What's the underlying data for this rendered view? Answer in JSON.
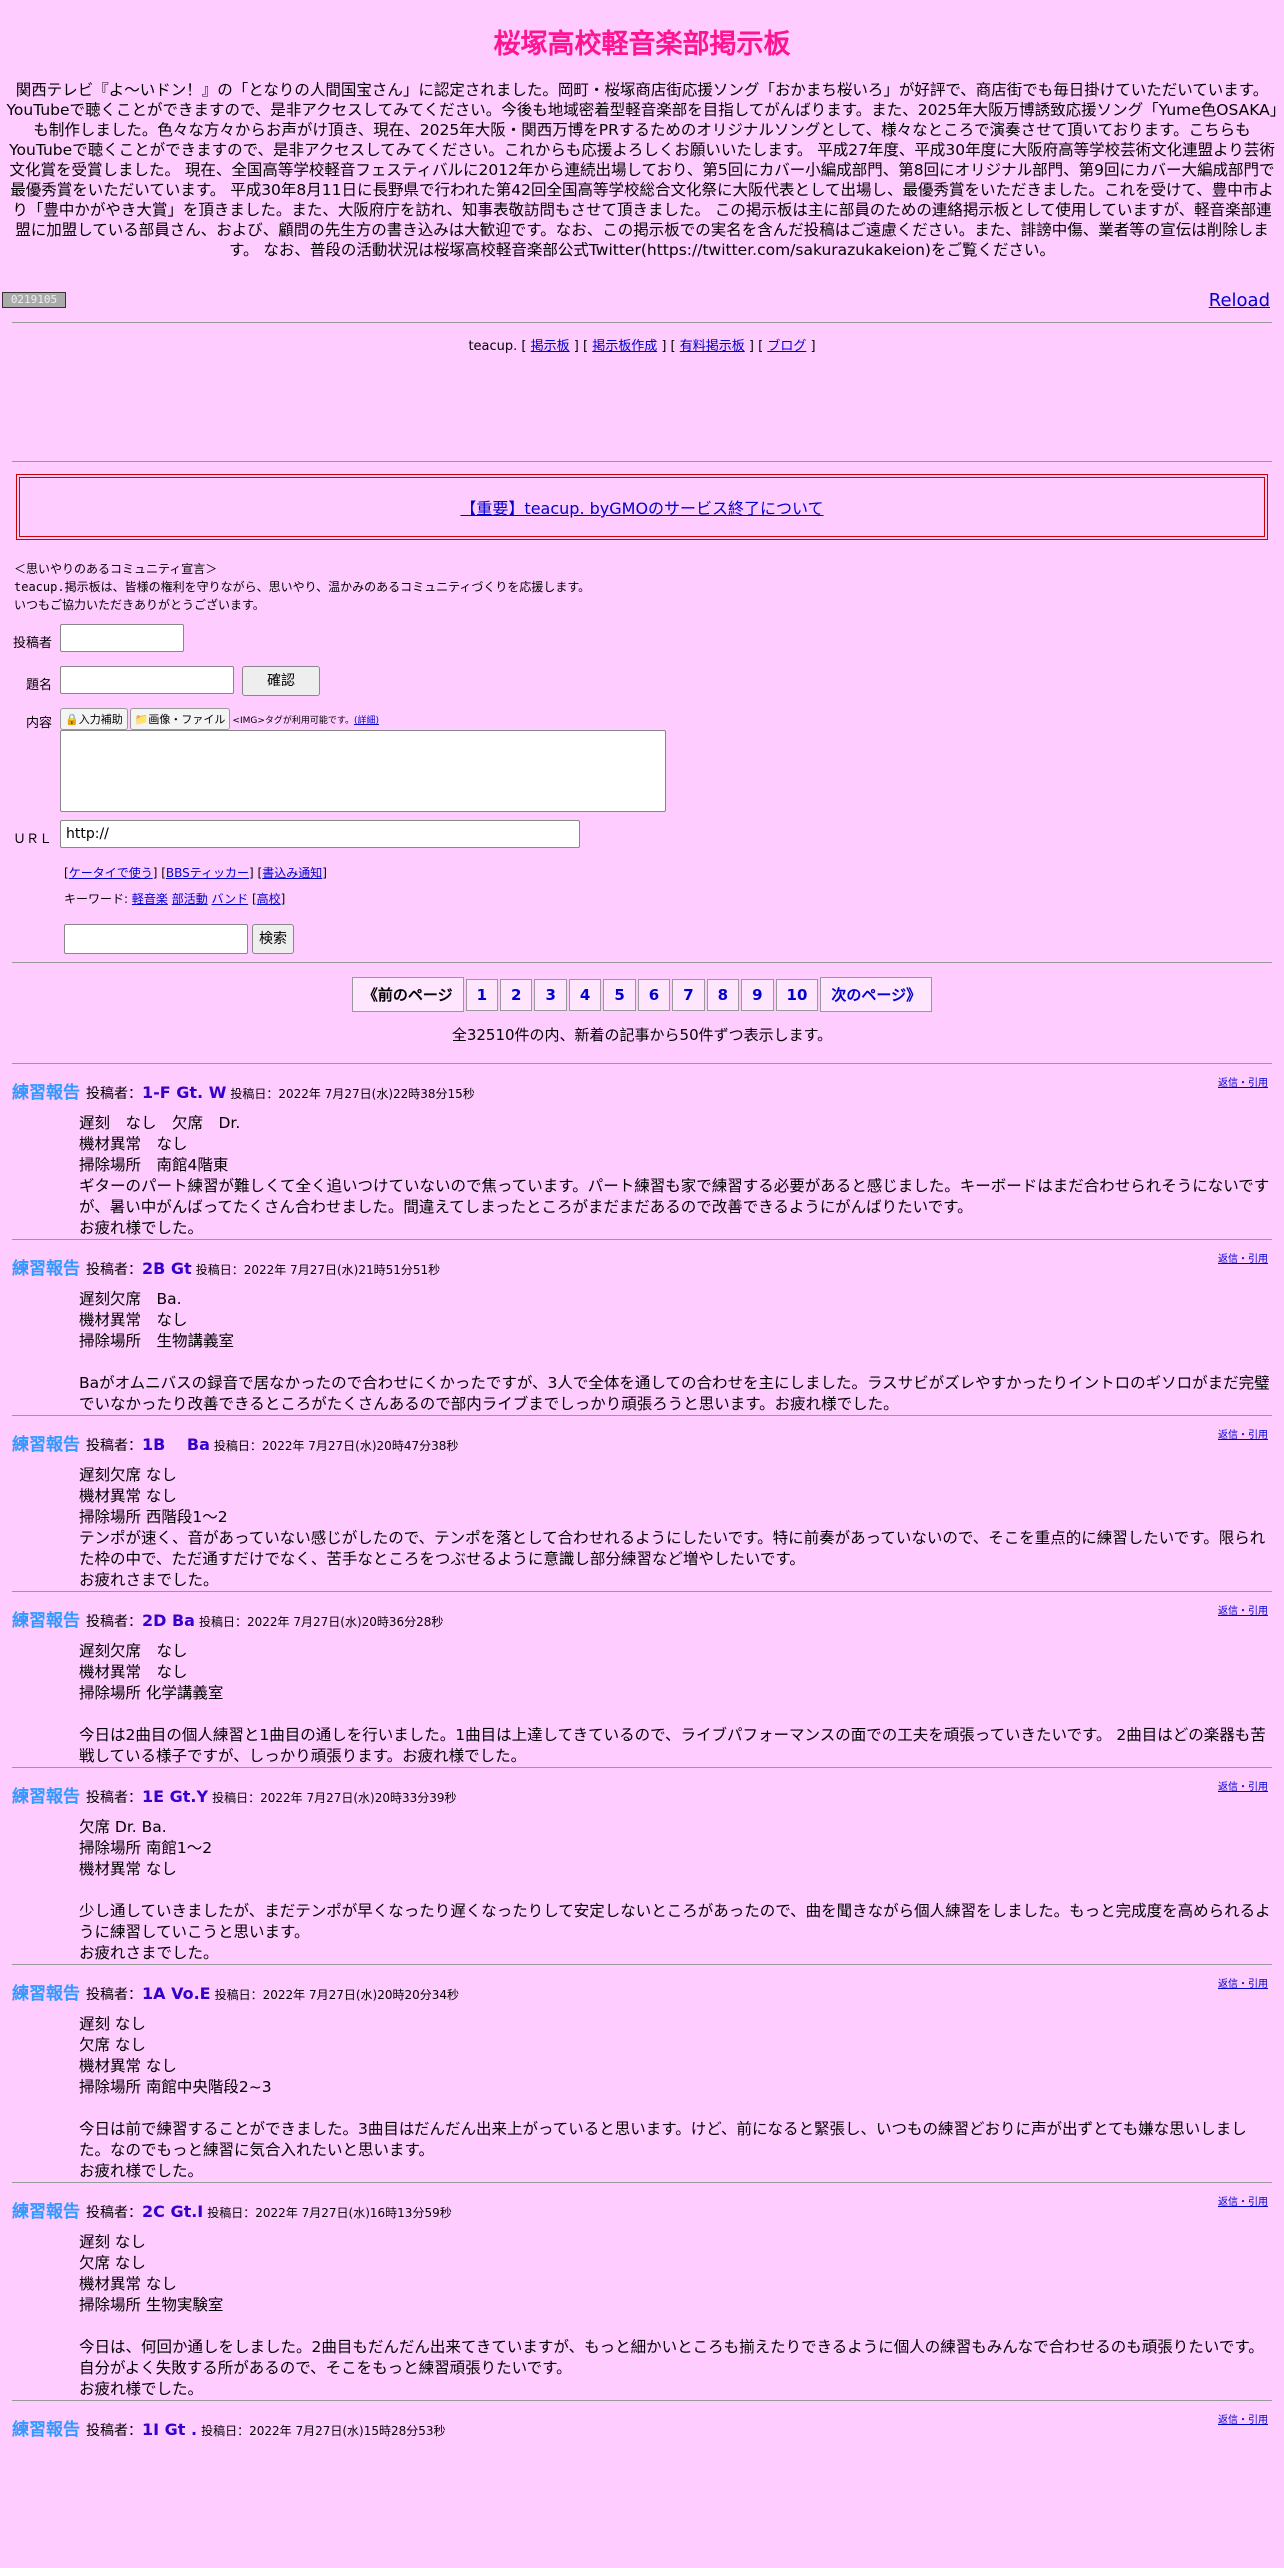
{
  "title": "桜塚高校軽音楽部掲示板",
  "intro": "関西テレビ『よ～いドン！』の「となりの人間国宝さん」に認定されました。岡町・桜塚商店街応援ソング「おかまち桜いろ」が好評で、商店街でも毎日掛けていただいています。YouTubeで聴くことができますので、是非アクセスしてみてください。今後も地域密着型軽音楽部を目指してがんばります。また、2025年大阪万博誘致応援ソング「Yume色OSAKA」も制作しました。色々な方々からお声がけ頂き、現在、2025年大阪・関西万博をPRするためのオリジナルソングとして、様々なところで演奏させて頂いております。こちらもYouTubeで聴くことができますので、是非アクセスしてみてください。これからも応援よろしくお願いいたします。 平成27年度、平成30年度に大阪府高等学校芸術文化連盟より芸術文化賞を受賞しました。 現在、全国高等学校軽音フェスティバルに2012年から連続出場しており、第5回にカバー小編成部門、第8回にオリジナル部門、第9回にカバー大編成部門で最優秀賞をいただいています。 平成30年8月11日に長野県で行われた第42回全国高等学校総合文化祭に大阪代表として出場し、最優秀賞をいただきました。これを受けて、豊中市より「豊中かがやき大賞」を頂きました。また、大阪府庁を訪れ、知事表敬訪問もさせて頂きました。 この掲示板は主に部員のための連絡掲示板として使用していますが、軽音楽部連盟に加盟している部員さん、および、顧問の先生方の書き込みは大歓迎です。なお、この掲示板での実名を含んだ投稿はご遠慮ください。また、誹謗中傷、業者等の宣伝は削除します。 なお、普段の活動状況は桜塚高校軽音楽部公式Twitter(https://twitter.com/sakurazukakeion)をご覧ください。",
  "counter": "0219105",
  "reload": "Reload",
  "teacup": {
    "prefix": "teacup. [ ",
    "links": [
      "掲示板",
      "掲示板作成",
      "有料掲示板",
      "ブログ"
    ]
  },
  "notice": "【重要】teacup. byGMOのサービス終了について",
  "community": {
    "line1": "＜思いやりのあるコミュニティ宣言＞",
    "line2": "teacup.掲示板は、皆様の権利を守りながら、思いやり、温かみのあるコミュニティづくりを応援します。",
    "line3": "いつもご協力いただきありがとうございます。"
  },
  "form": {
    "author_label": "投稿者",
    "subject_label": "題名",
    "confirm_button": "確認",
    "content_label": "内容",
    "tool_input": "入力補助",
    "tool_image": "画像・ファイル",
    "img_note": "<IMG>タグが利用可能です。",
    "img_detail": "(詳細)",
    "url_label": "ＵＲＬ",
    "url_value": "http://",
    "links": [
      "ケータイで使う",
      "BBSティッカー",
      "書込み通知"
    ],
    "keyword_label": "キーワード: ",
    "keywords": [
      "軽音楽",
      "部活動",
      "バンド",
      "高校"
    ],
    "search_button": "検索"
  },
  "pager": {
    "prev": "《前のページ",
    "pages": [
      "1",
      "2",
      "3",
      "4",
      "5",
      "6",
      "7",
      "8",
      "9",
      "10"
    ],
    "next": "次のページ》"
  },
  "total": "全32510件の内、新着の記事から50件ずつ表示します。",
  "post_label": "投稿者：",
  "date_label": "投稿日：",
  "reply_label": "返信・引用",
  "posts": [
    {
      "title": "練習報告",
      "author": "1-F Gt. W",
      "date": "2022年 7月27日(水)22時38分15秒",
      "body": "遅刻　なし　欠席　Dr.\n機材異常　なし\n掃除場所　南館4階東\nギターのパート練習が難しくて全く追いつけていないので焦っています。パート練習も家で練習する必要があると感じました。キーボードはまだ合わせられそうにないですが、暑い中がんばってたくさん合わせました。間違えてしまったところがまだまだあるので改善できるようにがんばりたいです。\nお疲れ様でした。\n"
    },
    {
      "title": "練習報告",
      "author": "2B Gt",
      "date": "2022年 7月27日(水)21時51分51秒",
      "body": "遅刻欠席　Ba.\n機材異常　なし\n掃除場所　生物講義室\n\nBaがオムニバスの録音で居なかったので合わせにくかったですが、3人で全体を通しての合わせを主にしました。ラスサビがズレやすかったりイントロのギソロがまだ完璧でいなかったり改善できるところがたくさんあるので部内ライブまでしっかり頑張ろうと思います。お疲れ様でした。"
    },
    {
      "title": "練習報告",
      "author": "1B　 Ba",
      "date": "2022年 7月27日(水)20時47分38秒",
      "body": "遅刻欠席 なし\n機材異常 なし\n掃除場所 西階段1～2\nテンポが速く、音があっていない感じがしたので、テンポを落として合わせれるようにしたいです。特に前奏があっていないので、そこを重点的に練習したいです。限られた枠の中で、ただ通すだけでなく、苦手なところをつぶせるように意識し部分練習など増やしたいです。\nお疲れさまでした。"
    },
    {
      "title": "練習報告",
      "author": "2D Ba",
      "date": "2022年 7月27日(水)20時36分28秒",
      "body": "遅刻欠席　なし\n機材異常　なし\n掃除場所 化学講義室\n\n今日は2曲目の個人練習と1曲目の通しを行いました。1曲目は上達してきているので、ライブパフォーマンスの面での工夫を頑張っていきたいです。 2曲目はどの楽器も苦戦している様子ですが、しっかり頑張ります。お疲れ様でした。"
    },
    {
      "title": "練習報告",
      "author": "1E Gt.Y",
      "date": "2022年 7月27日(水)20時33分39秒",
      "body": "欠席 Dr. Ba.\n掃除場所 南館1～2\n機材異常 なし\n\n少し通していきましたが、まだテンポが早くなったり遅くなったりして安定しないところがあったので、曲を聞きながら個人練習をしました。もっと完成度を高められるように練習していこうと思います。\nお疲れさまでした。\n"
    },
    {
      "title": "練習報告",
      "author": "1A Vo.E",
      "date": "2022年 7月27日(水)20時20分34秒",
      "body": "遅刻 なし\n欠席 なし\n機材異常 なし\n掃除場所 南館中央階段2~3\n\n今日は前で練習することができました。3曲目はだんだん出来上がっていると思います。けど、前になると緊張し、いつもの練習どおりに声が出ずとても嫌な思いしました。なのでもっと練習に気合入れたいと思います。\nお疲れ様でした。"
    },
    {
      "title": "練習報告",
      "author": "2C Gt.I",
      "date": "2022年 7月27日(水)16時13分59秒",
      "body": "遅刻 なし\n欠席 なし\n機材異常 なし\n掃除場所 生物実験室\n\n今日は、何回か通しをしました。2曲目もだんだん出来てきていますが、もっと細かいところも揃えたりできるように個人の練習もみんなで合わせるのも頑張りたいです。自分がよく失敗する所があるので、そこをもっと練習頑張りたいです。\nお疲れ様でした。"
    },
    {
      "title": "練習報告",
      "author": "1I Gt .",
      "date": "2022年 7月27日(水)15時28分53秒",
      "body": ""
    }
  ]
}
